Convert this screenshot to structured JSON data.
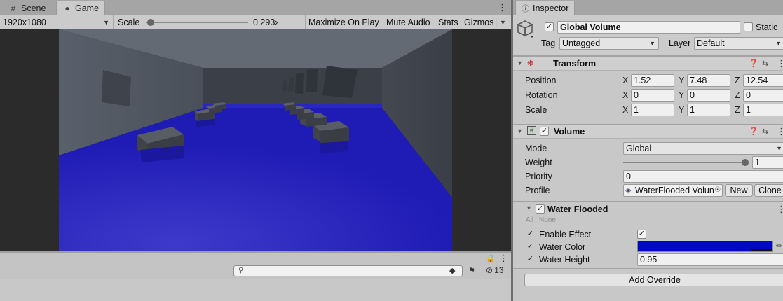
{
  "scene_tab": {
    "label": "Scene",
    "icon": "grid-icon"
  },
  "game_tab": {
    "label": "Game",
    "icon": "gamepad-icon"
  },
  "game_toolbar": {
    "resolution": "1920x1080",
    "scale_label": "Scale",
    "scale_value": "0.293›",
    "scale_fraction": 0.05,
    "maximize_on_play": "Maximize On Play",
    "mute_audio": "Mute Audio",
    "stats": "Stats",
    "gizmos": "Gizmos"
  },
  "console": {
    "search_icon": "search-icon",
    "message_count": "13"
  },
  "inspector": {
    "tab_label": "Inspector",
    "object": {
      "active": true,
      "name": "Global Volume",
      "static_label": "Static",
      "tag_label": "Tag",
      "tag_value": "Untagged",
      "layer_label": "Layer",
      "layer_value": "Default"
    },
    "transform": {
      "title": "Transform",
      "rows": [
        {
          "label": "Position",
          "x": "1.52",
          "y": "7.48",
          "z": "12.54"
        },
        {
          "label": "Rotation",
          "x": "0",
          "y": "0",
          "z": "0"
        },
        {
          "label": "Scale",
          "x": "1",
          "y": "1",
          "z": "1"
        }
      ],
      "axis_x": "X",
      "axis_y": "Y",
      "axis_z": "Z"
    },
    "volume": {
      "title": "Volume",
      "enabled": true,
      "mode_label": "Mode",
      "mode_value": "Global",
      "weight_label": "Weight",
      "weight_value": "1",
      "weight_fraction": 1.0,
      "priority_label": "Priority",
      "priority_value": "0",
      "profile_label": "Profile",
      "profile_value": "WaterFlooded Volun",
      "new_button": "New",
      "clone_button": "Clone"
    },
    "water_flooded": {
      "title": "Water Flooded",
      "all_label": "All",
      "none_label": "None",
      "enable_effect_label": "Enable Effect",
      "enable_effect_checked": true,
      "water_color_label": "Water Color",
      "water_color": "#0008c8",
      "water_height_label": "Water Height",
      "water_height_value": "0.95"
    },
    "add_override": "Add Override"
  },
  "colors": {
    "water": "#1c17b8",
    "wall": "#4f5560",
    "ceiling": "#626872"
  }
}
